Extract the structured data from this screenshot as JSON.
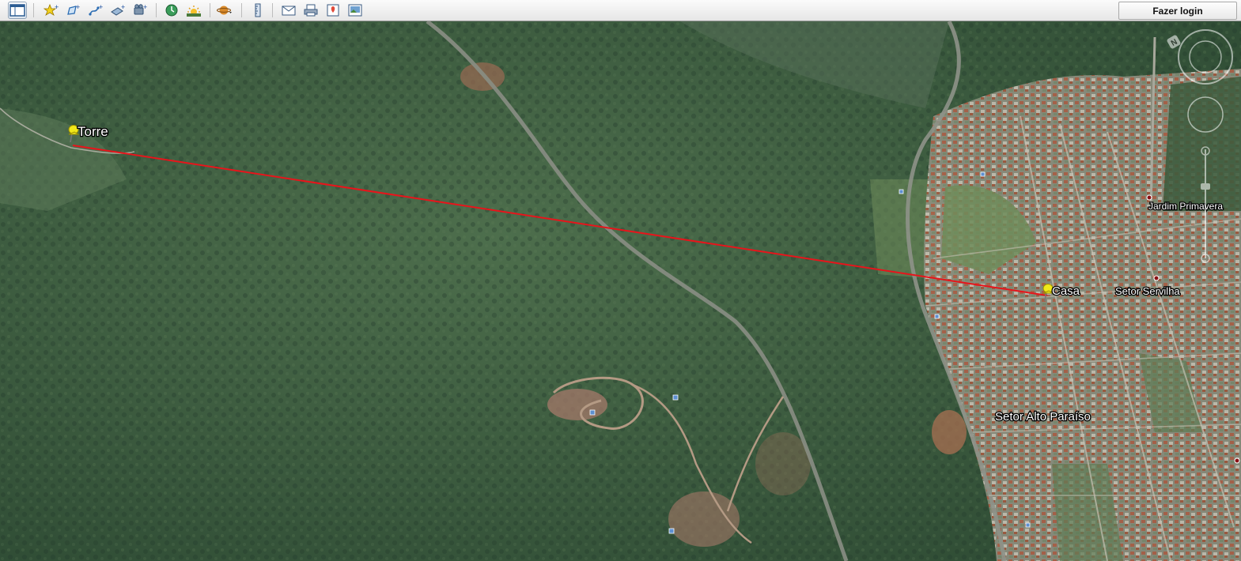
{
  "toolbar": {
    "buttons": [
      {
        "name": "sidebar-toggle-icon"
      },
      {
        "name": "add-placemark-icon"
      },
      {
        "name": "add-polygon-icon"
      },
      {
        "name": "add-path-icon"
      },
      {
        "name": "add-image-overlay-icon"
      },
      {
        "name": "record-tour-icon"
      },
      {
        "name": "historical-imagery-icon"
      },
      {
        "name": "sunlight-icon"
      },
      {
        "name": "switch-planet-icon"
      },
      {
        "name": "ruler-icon"
      },
      {
        "name": "email-icon"
      },
      {
        "name": "print-icon"
      },
      {
        "name": "view-in-maps-icon"
      },
      {
        "name": "save-image-icon"
      }
    ],
    "login_label": "Fazer login"
  },
  "map": {
    "placemarks": [
      {
        "label": "Torre"
      },
      {
        "label": "Casa"
      }
    ],
    "place_labels": [
      {
        "label": "Jardim Primavera"
      },
      {
        "label": "Setor Servilha"
      },
      {
        "label": "Setor Alto Paraíso"
      }
    ],
    "path_color": "#e8141b",
    "pin_color": "#f1e81a"
  },
  "navigation": {
    "north_label": "N"
  }
}
